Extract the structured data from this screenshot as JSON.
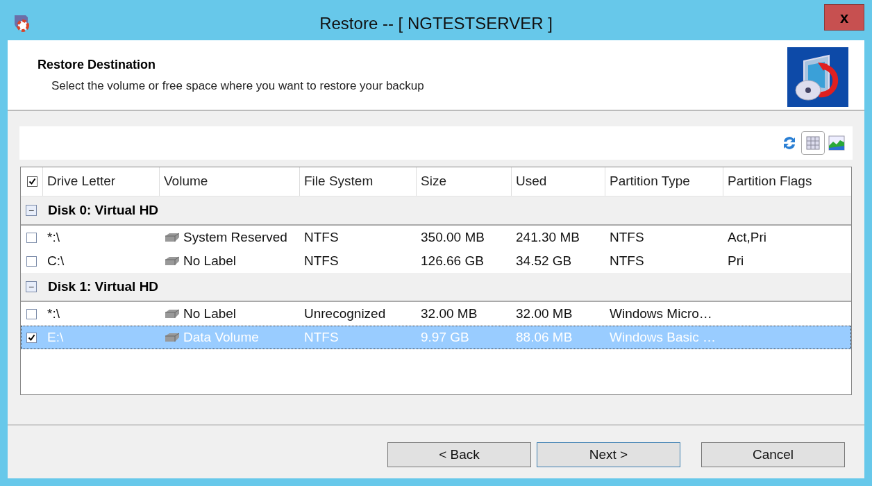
{
  "window": {
    "title": "Restore -- [ NGTESTSERVER ]",
    "close": "x"
  },
  "header": {
    "title": "Restore Destination",
    "subtitle": "Select the volume or free space where you want to restore your backup"
  },
  "toolbar": [
    {
      "kind": "refresh",
      "selected": false
    },
    {
      "kind": "grid",
      "selected": true
    },
    {
      "kind": "chart",
      "selected": false
    }
  ],
  "table": {
    "all_checked": true,
    "columns": [
      "Drive Letter",
      "Volume",
      "File System",
      "Size",
      "Used",
      "Partition Type",
      "Partition Flags"
    ],
    "groups": [
      {
        "title": "Disk 0: Virtual HD",
        "expanded": true,
        "expander": "−",
        "rows": [
          {
            "checked": false,
            "selected": false,
            "cells": [
              "*:\\",
              "System Reserved",
              "NTFS",
              "350.00 MB",
              "241.30 MB",
              "NTFS",
              "Act,Pri"
            ]
          },
          {
            "checked": false,
            "selected": false,
            "cells": [
              "C:\\",
              "No Label",
              "NTFS",
              "126.66 GB",
              "34.52 GB",
              "NTFS",
              "Pri"
            ]
          }
        ]
      },
      {
        "title": "Disk 1: Virtual HD",
        "expanded": true,
        "expander": "−",
        "rows": [
          {
            "checked": false,
            "selected": false,
            "cells": [
              "*:\\",
              "No Label",
              "Unrecognized",
              "32.00 MB",
              "32.00 MB",
              "Windows Micro…",
              ""
            ]
          },
          {
            "checked": true,
            "selected": true,
            "cells": [
              "E:\\",
              "Data Volume",
              "NTFS",
              "9.97 GB",
              "88.06 MB",
              "Windows Basic …",
              ""
            ]
          }
        ]
      }
    ]
  },
  "buttons": [
    {
      "label": "< Back",
      "focused": false
    },
    {
      "label": "Next >",
      "focused": true
    },
    {
      "label": "Cancel",
      "focused": false
    }
  ]
}
